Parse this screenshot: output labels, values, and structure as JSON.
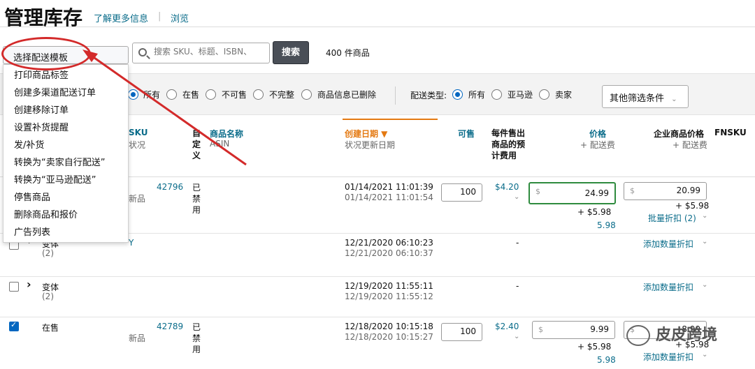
{
  "header": {
    "title": "管理库存",
    "learn_more": "了解更多信息",
    "separator": "|",
    "browse": "浏览"
  },
  "toolbar": {
    "action_label": "选择配送模板",
    "search_placeholder": "搜索 SKU、标题、ISBN、",
    "search_button": "搜索",
    "item_count": "400 件商品"
  },
  "action_menu": {
    "items": [
      "打印商品标签",
      "创建多渠道配送订单",
      "创建移除订单",
      "设置补货提醒",
      "发/补货",
      "转换为“卖家自行配送”",
      "转换为“亚马逊配送”",
      "停售商品",
      "删除商品和报价",
      "广告列表"
    ]
  },
  "filters": {
    "status_options": [
      "所有",
      "在售",
      "不可售",
      "不完整",
      "商品信息已删除"
    ],
    "status_selected": "所有",
    "fulfillment_label": "配送类型:",
    "fulfillment_options": [
      "所有",
      "亚马逊",
      "卖家"
    ],
    "fulfillment_selected": "所有",
    "more_filters": "其他筛选条件"
  },
  "table": {
    "headers": {
      "sku": "SKU",
      "sku_sub": "状况",
      "custom": "自定义",
      "product_name": "商品名称",
      "product_name_sub": "ASIN",
      "created": "创建日期 ▼",
      "created_sub": "状况更新日期",
      "available": "可售",
      "fee": "每件售出商品的预计费用",
      "price": "价格",
      "price_sub": "+ 配送费",
      "business_price": "企业商品价格",
      "business_price_sub": "+ 配送费",
      "fnsku": "FNSKU"
    },
    "rows": [
      {
        "sku_id": "42796",
        "condition": "新品",
        "custom": "已禁用",
        "created": "01/14/2021 11:01:39",
        "updated": "01/14/2021 11:01:54",
        "quantity": "100",
        "fee": "$4.20",
        "price": "24.99",
        "shipping": "+ $5.98",
        "total": "5.98",
        "business_price": "20.99",
        "business_shipping": "+ $5.98",
        "discount": "批量折扣 (2)"
      },
      {
        "status": "变体",
        "count": "(2)",
        "sku_tail": "Y",
        "created": "12/21/2020 06:10:23",
        "updated": "12/21/2020 06:10:37",
        "fee": "-",
        "discount": "添加数量折扣"
      },
      {
        "status": "变体",
        "count": "(2)",
        "created": "12/19/2020 11:55:11",
        "updated": "12/19/2020 11:55:12",
        "fee": "-",
        "discount": "添加数量折扣"
      },
      {
        "status": "在售",
        "sku_id": "42789",
        "condition": "新品",
        "custom": "已禁用",
        "created": "12/18/2020 10:15:18",
        "updated": "12/18/2020 10:15:27",
        "quantity": "100",
        "fee": "$2.40",
        "price": "9.99",
        "shipping": "+ $5.98",
        "total": "5.98",
        "business_price": "8.99",
        "business_shipping": "+ $5.98",
        "discount": "添加数量折扣"
      }
    ]
  },
  "watermark": "皮皮跨境",
  "colors": {
    "link": "#0a6c8a",
    "accent_orange": "#e47911",
    "annotation_red": "#d32a2a"
  }
}
